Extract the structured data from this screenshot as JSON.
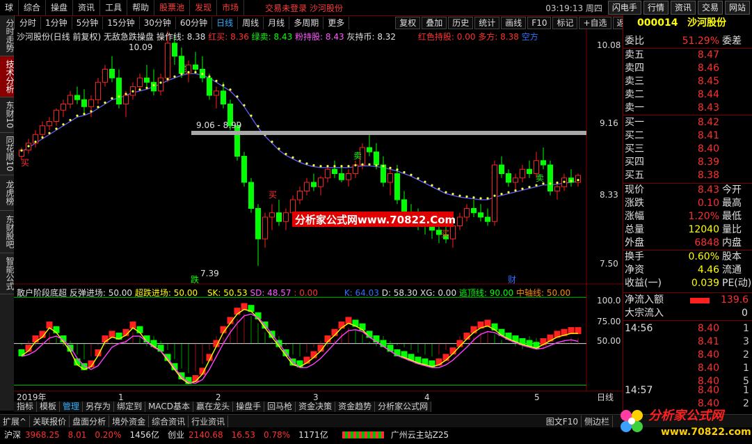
{
  "topbar": {
    "items": [
      "球",
      "综合",
      "操盘",
      "资讯",
      "工具",
      "帮助",
      "股票池",
      "发现",
      "市场"
    ],
    "notice": "交易未登录 沙河股份",
    "time": "03:19:13 周四",
    "buttons": [
      "闪电手",
      "行情",
      "资讯",
      "交易",
      "网站"
    ]
  },
  "toolbar": {
    "periods": [
      "分时",
      "1分钟",
      "5分钟",
      "15分钟",
      "30分钟",
      "60分钟",
      "日线",
      "周线",
      "月线",
      "多周期",
      "更多"
    ],
    "active": "日线",
    "right": [
      "复权",
      "叠加",
      "历史",
      "统计",
      "画线",
      "F10",
      "标记",
      "+自选",
      "返回"
    ]
  },
  "lefttabs": [
    "分时走势",
    "技术分析",
    "东财10",
    "同花顺10",
    "龙虎榜",
    "东财股吧",
    "智能公式"
  ],
  "main_info": {
    "name": "沙河股份(日线 前复权)",
    "formula": "无敌急跌操盘",
    "czx": "操作线: 8.38",
    "hongmai": "红买: 8.36",
    "lvmai": "绿卖: 8.43",
    "fen": "粉持股: 8.43",
    "hui": "灰持币: 8.32",
    "hongse": "红色持股: 0.00",
    "duofang": "多方: 8.38",
    "kongfang": "空方"
  },
  "yaxis": [
    "10.08",
    "9.16",
    "8.33",
    "7.50"
  ],
  "sub_yaxis": [
    "100.0",
    "75.00",
    "50.00"
  ],
  "annotations": {
    "high": "10.09",
    "low": "7.39",
    "range": "9.06 - 8.99",
    "watermark": "分析家公式网www.70822.Com",
    "die": "跌",
    "cai": "财",
    "sell": "卖",
    "buy": "买"
  },
  "xaxis": [
    "2019年",
    "1",
    "2",
    "3",
    "4",
    "5"
  ],
  "sub_info": {
    "name": "散户阶段底超",
    "ft": "反弹进场: 50.00",
    "cd": "超跌进场: 50.00",
    "sk": "SK: 50.53",
    "sd": "SD: 48.57",
    "blank": ": 0.00",
    "k": "K: 64.03",
    "d": "D: 58.30",
    "xg": "XG: 0.00",
    "ty": "逃顶线: 90.00",
    "zz": "中轴线: 50.00"
  },
  "quote": {
    "code": "000014",
    "name": "沙河股份",
    "weibi_k": "委比",
    "weibi_v": "51.29%",
    "weicha": "委差",
    "asks": [
      [
        "卖五",
        "8.47"
      ],
      [
        "卖四",
        "8.46"
      ],
      [
        "卖三",
        "8.45"
      ],
      [
        "卖二",
        "8.44"
      ],
      [
        "卖一",
        "8.43"
      ]
    ],
    "bids": [
      [
        "买一",
        "8.42"
      ],
      [
        "买二",
        "8.41"
      ],
      [
        "买三",
        "8.40"
      ],
      [
        "买四",
        "8.39"
      ],
      [
        "买五",
        "8.38"
      ]
    ],
    "stats": [
      [
        "现价",
        "8.43",
        "今开"
      ],
      [
        "涨跌",
        "0.10",
        "最高"
      ],
      [
        "涨幅",
        "1.20%",
        "最低"
      ],
      [
        "总量",
        "12040",
        "量比"
      ],
      [
        "外盘",
        "6848",
        "内盘"
      ],
      [
        "换手",
        "0.60%",
        "股本"
      ],
      [
        "净资",
        "4.46",
        "流通"
      ],
      [
        "收益(一)",
        "0.039",
        "PE(动)"
      ]
    ],
    "netin_k": "净流入额",
    "netin_v": "139.6",
    "dadan_k": "大宗流入",
    "dadan_v": "0",
    "ticks": [
      [
        "14:56",
        "8.40",
        "1"
      ],
      [
        "",
        "8.41",
        "3"
      ],
      [
        "",
        "8.40",
        "2"
      ],
      [
        "",
        "8.40",
        "1"
      ],
      [
        "",
        "8.40",
        "5"
      ],
      [
        "14:57",
        "8.40",
        "1"
      ],
      [
        "",
        "8.40",
        "2"
      ]
    ]
  },
  "bottom_tabs": [
    "指标",
    "模板",
    "管理",
    "另存为",
    "绑定到",
    "MACD基本",
    "赢在龙头",
    "操盘手",
    "回马枪",
    "资金决策",
    "资金趋势",
    "分析家公式网"
  ],
  "bottom_tabs2": [
    "扩展^",
    "关联报价",
    "盘面分析",
    "境外资金",
    "综合资讯",
    "行业资讯"
  ],
  "bottom_right": [
    "日线",
    "图文F10",
    "侧边栏"
  ],
  "status": {
    "hs": "沪深",
    "hs_v": "3968.25",
    "hs_c": "8.01",
    "hs_p": "0.20%",
    "hs_a": "1456亿",
    "cy": "创业",
    "cy_v": "2140.68",
    "cy_c": "16.53",
    "cy_p": "0.78%",
    "cy_a": "1171亿",
    "site": "广州云主站Z25"
  },
  "logo": {
    "t1": "分析家公式网",
    "t2": "www.70822.com"
  },
  "chart_data": {
    "type": "candlestick",
    "candles": [
      [
        8.65,
        8.75,
        8.6,
        8.72
      ],
      [
        8.72,
        8.85,
        8.68,
        8.8
      ],
      [
        8.8,
        8.95,
        8.75,
        8.9
      ],
      [
        8.9,
        9.05,
        8.85,
        9.0
      ],
      [
        9.0,
        9.1,
        8.95,
        9.05
      ],
      [
        9.05,
        9.2,
        9.0,
        9.18
      ],
      [
        9.18,
        9.3,
        9.1,
        9.25
      ],
      [
        9.25,
        9.4,
        9.2,
        9.35
      ],
      [
        9.35,
        9.45,
        9.25,
        9.3
      ],
      [
        9.3,
        9.42,
        9.15,
        9.22
      ],
      [
        9.22,
        9.35,
        9.1,
        9.3
      ],
      [
        9.3,
        9.55,
        9.25,
        9.5
      ],
      [
        9.5,
        9.7,
        9.45,
        9.65
      ],
      [
        9.65,
        9.8,
        9.5,
        9.55
      ],
      [
        9.55,
        9.65,
        9.2,
        9.25
      ],
      [
        9.25,
        9.4,
        9.1,
        9.35
      ],
      [
        9.35,
        9.5,
        9.3,
        9.45
      ],
      [
        9.45,
        9.6,
        9.4,
        9.55
      ],
      [
        9.55,
        9.7,
        9.45,
        9.5
      ],
      [
        9.5,
        9.65,
        9.35,
        9.4
      ],
      [
        9.4,
        9.6,
        9.35,
        9.55
      ],
      [
        9.55,
        10.09,
        9.5,
        9.95
      ],
      [
        9.95,
        10.05,
        9.7,
        9.8
      ],
      [
        9.8,
        9.9,
        9.55,
        9.6
      ],
      [
        9.6,
        9.75,
        9.5,
        9.7
      ],
      [
        9.7,
        9.85,
        9.6,
        9.65
      ],
      [
        9.65,
        9.8,
        9.5,
        9.55
      ],
      [
        9.55,
        9.6,
        9.3,
        9.35
      ],
      [
        9.35,
        9.45,
        9.2,
        9.4
      ],
      [
        9.4,
        9.5,
        9.2,
        9.25
      ],
      [
        9.25,
        9.3,
        8.95,
        9.0
      ],
      [
        9.0,
        9.05,
        8.6,
        8.65
      ],
      [
        8.65,
        8.7,
        8.3,
        8.35
      ],
      [
        8.35,
        8.4,
        8.0,
        8.05
      ],
      [
        8.05,
        8.1,
        7.39,
        7.7
      ],
      [
        7.7,
        8.0,
        7.6,
        7.95
      ],
      [
        7.95,
        8.1,
        7.8,
        8.0
      ],
      [
        8.0,
        8.15,
        7.85,
        7.9
      ],
      [
        7.9,
        8.05,
        7.8,
        8.0
      ],
      [
        8.0,
        8.2,
        7.95,
        8.15
      ],
      [
        8.15,
        8.3,
        8.1,
        8.25
      ],
      [
        8.25,
        8.4,
        8.2,
        8.35
      ],
      [
        8.35,
        8.45,
        8.25,
        8.3
      ],
      [
        8.3,
        8.42,
        8.2,
        8.4
      ],
      [
        8.4,
        8.55,
        8.35,
        8.5
      ],
      [
        8.5,
        8.6,
        8.4,
        8.45
      ],
      [
        8.45,
        8.55,
        8.35,
        8.38
      ],
      [
        8.38,
        8.5,
        8.3,
        8.45
      ],
      [
        8.45,
        8.6,
        8.4,
        8.55
      ],
      [
        8.55,
        8.8,
        8.5,
        8.75
      ],
      [
        8.75,
        8.9,
        8.65,
        8.7
      ],
      [
        8.7,
        8.8,
        8.5,
        8.55
      ],
      [
        8.55,
        8.65,
        8.3,
        8.35
      ],
      [
        8.35,
        8.5,
        8.2,
        8.45
      ],
      [
        8.45,
        8.55,
        8.1,
        8.15
      ],
      [
        8.15,
        8.25,
        7.95,
        8.0
      ],
      [
        8.0,
        8.1,
        7.85,
        7.95
      ],
      [
        7.95,
        8.05,
        7.8,
        7.9
      ],
      [
        7.9,
        8.0,
        7.75,
        7.85
      ],
      [
        7.85,
        7.95,
        7.7,
        7.8
      ],
      [
        7.8,
        7.9,
        7.65,
        7.75
      ],
      [
        7.75,
        7.85,
        7.65,
        7.7
      ],
      [
        7.7,
        7.9,
        7.6,
        7.85
      ],
      [
        7.85,
        8.0,
        7.8,
        7.95
      ],
      [
        7.95,
        8.1,
        7.9,
        8.05
      ],
      [
        8.05,
        8.15,
        7.95,
        8.0
      ],
      [
        8.0,
        8.1,
        7.9,
        7.95
      ],
      [
        7.95,
        8.05,
        7.85,
        7.9
      ],
      [
        7.9,
        8.6,
        7.85,
        8.55
      ],
      [
        8.55,
        8.65,
        8.4,
        8.45
      ],
      [
        8.45,
        8.5,
        8.3,
        8.35
      ],
      [
        8.35,
        8.45,
        8.25,
        8.4
      ],
      [
        8.4,
        8.55,
        8.35,
        8.5
      ],
      [
        8.5,
        8.6,
        8.4,
        8.45
      ],
      [
        8.45,
        8.7,
        8.4,
        8.6
      ],
      [
        8.6,
        8.75,
        8.5,
        8.55
      ],
      [
        8.55,
        8.6,
        8.2,
        8.25
      ],
      [
        8.25,
        8.35,
        8.15,
        8.3
      ],
      [
        8.3,
        8.45,
        8.25,
        8.4
      ],
      [
        8.4,
        8.5,
        8.3,
        8.35
      ],
      [
        8.35,
        8.45,
        8.3,
        8.43
      ]
    ],
    "ma_line": [
      8.7,
      8.75,
      8.8,
      8.85,
      8.9,
      8.95,
      9.0,
      9.05,
      9.1,
      9.12,
      9.15,
      9.2,
      9.25,
      9.3,
      9.32,
      9.35,
      9.38,
      9.4,
      9.42,
      9.45,
      9.48,
      9.52,
      9.55,
      9.58,
      9.6,
      9.6,
      9.58,
      9.55,
      9.5,
      9.45,
      9.4,
      9.32,
      9.22,
      9.1,
      8.98,
      8.88,
      8.8,
      8.72,
      8.66,
      8.62,
      8.58,
      8.55,
      8.53,
      8.52,
      8.52,
      8.52,
      8.52,
      8.52,
      8.53,
      8.54,
      8.54,
      8.53,
      8.52,
      8.5,
      8.48,
      8.45,
      8.42,
      8.38,
      8.34,
      8.3,
      8.26,
      8.22,
      8.2,
      8.18,
      8.17,
      8.16,
      8.15,
      8.15,
      8.18,
      8.2,
      8.22,
      8.24,
      8.26,
      8.28,
      8.3,
      8.32,
      8.32,
      8.33,
      8.34,
      8.35,
      8.36
    ],
    "sub_series": {
      "k": [
        40,
        45,
        55,
        60,
        70,
        65,
        55,
        45,
        30,
        25,
        28,
        40,
        55,
        60,
        58,
        62,
        70,
        65,
        55,
        50,
        45,
        35,
        25,
        15,
        10,
        12,
        20,
        35,
        50,
        65,
        75,
        85,
        90,
        88,
        80,
        70,
        60,
        50,
        40,
        30,
        28,
        32,
        38,
        45,
        55,
        62,
        70,
        75,
        72,
        68,
        60,
        55,
        50,
        45,
        40,
        38,
        35,
        32,
        30,
        28,
        30,
        35,
        42,
        50,
        58,
        65,
        70,
        72,
        68,
        62,
        58,
        55,
        52,
        50,
        48,
        52,
        56,
        60,
        62,
        64,
        64
      ],
      "d": [
        42,
        44,
        48,
        55,
        62,
        64,
        60,
        52,
        40,
        32,
        28,
        32,
        42,
        52,
        56,
        58,
        64,
        64,
        58,
        52,
        48,
        40,
        30,
        20,
        14,
        13,
        17,
        28,
        42,
        56,
        68,
        78,
        86,
        88,
        84,
        76,
        66,
        56,
        46,
        36,
        30,
        30,
        34,
        40,
        48,
        56,
        64,
        70,
        71,
        69,
        63,
        58,
        53,
        48,
        43,
        40,
        37,
        34,
        32,
        30,
        30,
        33,
        38,
        45,
        52,
        60,
        66,
        69,
        68,
        64,
        60,
        57,
        54,
        52,
        50,
        51,
        54,
        57,
        59,
        60,
        58.3
      ]
    },
    "sub_ylim": [
      0,
      110
    ]
  }
}
